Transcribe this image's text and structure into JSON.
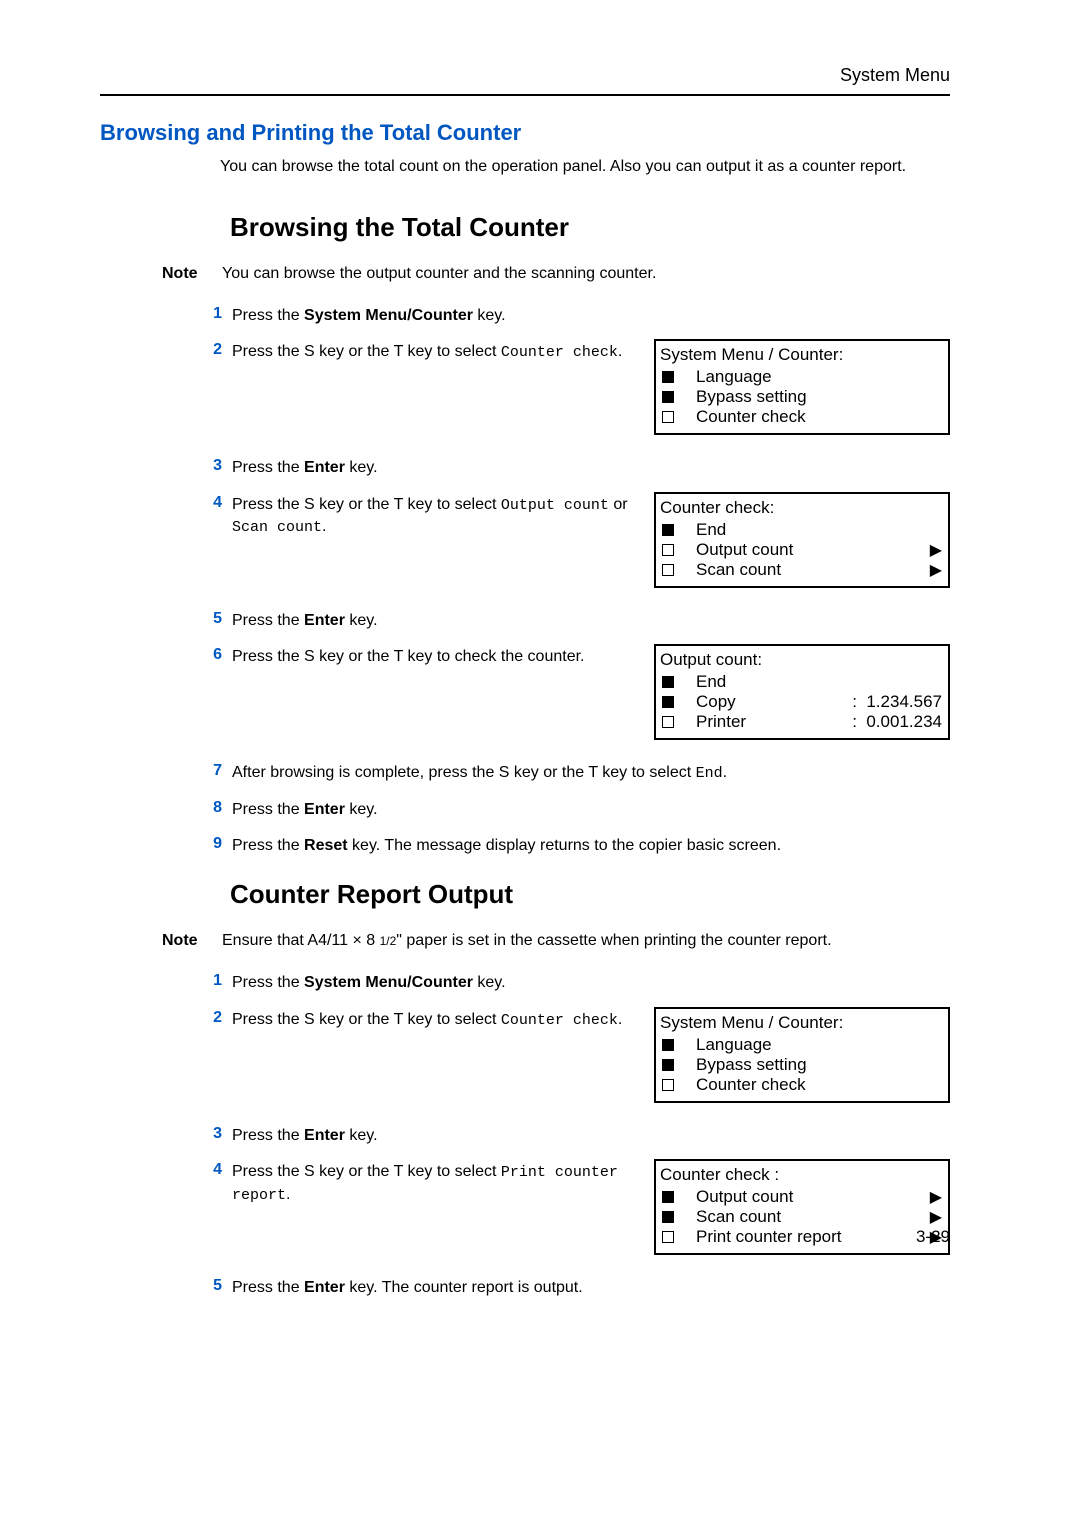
{
  "header": {
    "right_label": "System Menu"
  },
  "section_title": "Browsing and Printing the Total Counter",
  "intro": "You can browse the total count on the operation panel. Also you can output it as a counter report.",
  "browse": {
    "heading": "Browsing the Total Counter",
    "note_label": "Note",
    "note_text": "You can browse the output counter and the scanning counter.",
    "steps": {
      "s1": {
        "num": "1",
        "prefix": "Press the ",
        "bold": "System Menu/Counter",
        "suffix": " key."
      },
      "s2": {
        "num": "2",
        "t1": "Press the  S  key or the  T  key to select ",
        "m1": "Counter check",
        "t2": "."
      },
      "s3": {
        "num": "3",
        "prefix": "Press the ",
        "bold": "Enter",
        "suffix": " key."
      },
      "s4": {
        "num": "4",
        "t1": "Press the  S  key or the  T  key to select ",
        "m1": "Output count",
        "t2": " or ",
        "m2": "Scan count",
        "t3": "."
      },
      "s5": {
        "num": "5",
        "prefix": "Press the ",
        "bold": "Enter",
        "suffix": " key."
      },
      "s6": {
        "num": "6",
        "text": "Press the  S  key or the  T  key to check the counter."
      },
      "s7": {
        "num": "7",
        "t1": "After browsing is complete, press the  S  key or the  T  key to select ",
        "m1": "End",
        "t2": "."
      },
      "s8": {
        "num": "8",
        "prefix": "Press the ",
        "bold": "Enter",
        "suffix": " key."
      },
      "s9": {
        "num": "9",
        "prefix": "Press the ",
        "bold": "Reset",
        "suffix": " key. The message display returns to the copier basic screen."
      }
    },
    "lcd1": {
      "title": "System Menu / Counter:",
      "r1": "Language",
      "r2": "Bypass setting",
      "r3": "Counter check"
    },
    "lcd2": {
      "title": "Counter check:",
      "r1": "End",
      "r2": "Output count",
      "r3": "Scan count"
    },
    "lcd3": {
      "title": "Output count:",
      "r1": "End",
      "r2l": "Copy",
      "r2v": ":  1.234.567",
      "r3l": "Printer",
      "r3v": ":  0.001.234"
    }
  },
  "report": {
    "heading": "Counter Report Output",
    "note_label": "Note",
    "note_t1": "Ensure that A4/11 × 8 ",
    "note_sub": "1/2",
    "note_t2": "\" paper is set in the cassette when printing the counter report.",
    "steps": {
      "s1": {
        "num": "1",
        "prefix": "Press the ",
        "bold": "System Menu/Counter",
        "suffix": " key."
      },
      "s2": {
        "num": "2",
        "t1": "Press the  S  key or the  T  key to select ",
        "m1": "Counter check",
        "t2": "."
      },
      "s3": {
        "num": "3",
        "prefix": "Press the ",
        "bold": "Enter",
        "suffix": " key."
      },
      "s4": {
        "num": "4",
        "t1": "Press the  S  key or the  T  key to select ",
        "m1": "Print counter report",
        "t2": "."
      },
      "s5": {
        "num": "5",
        "prefix": "Press the ",
        "bold": "Enter",
        "suffix": " key. The counter report is output."
      }
    },
    "lcd1": {
      "title": "System Menu / Counter:",
      "r1": "Language",
      "r2": "Bypass setting",
      "r3": "Counter check"
    },
    "lcd2": {
      "title": "Counter check :",
      "r1": "Output count",
      "r2": "Scan count",
      "r3": "Print counter report"
    }
  },
  "page_num": "3-29",
  "arrow": "▶"
}
